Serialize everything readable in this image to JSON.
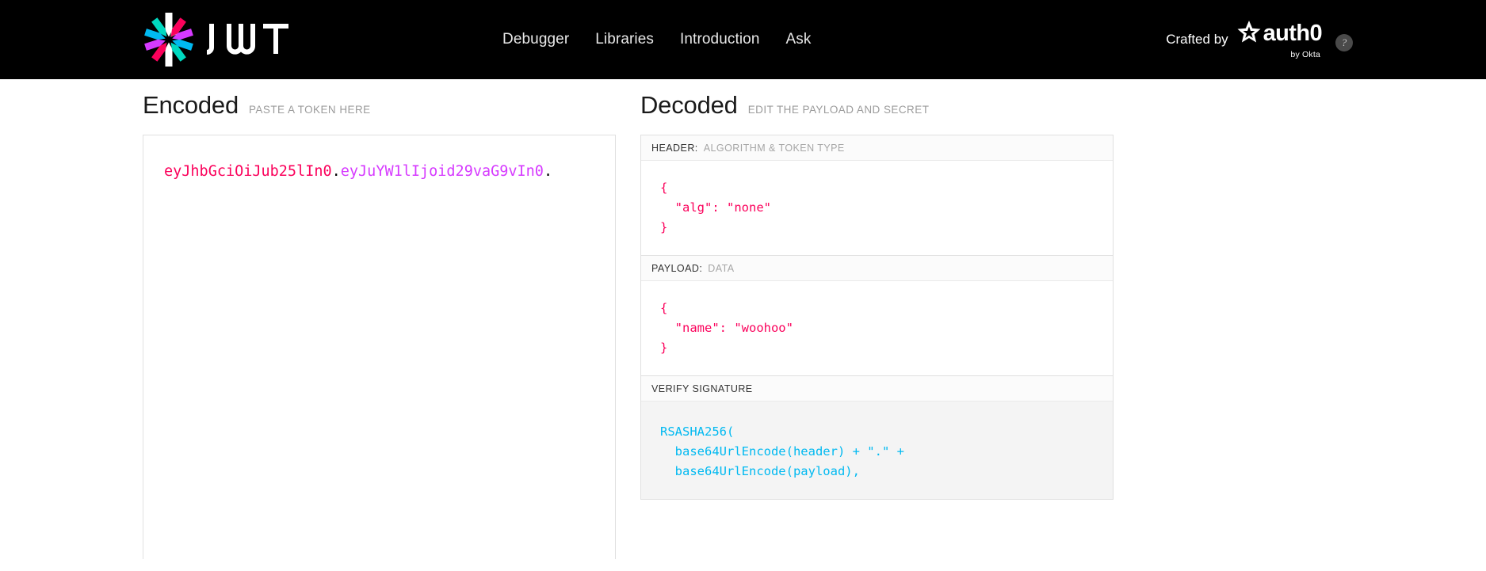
{
  "header": {
    "brand_name": "JWT",
    "logo_icon": "jwt-starburst-logo",
    "nav": [
      {
        "label": "Debugger",
        "name": "nav-debugger"
      },
      {
        "label": "Libraries",
        "name": "nav-libraries"
      },
      {
        "label": "Introduction",
        "name": "nav-introduction"
      },
      {
        "label": "Ask",
        "name": "nav-ask"
      }
    ],
    "crafted_by_label": "Crafted by",
    "auth0_wordmark": "auth0",
    "auth0_tagline": "by Okta",
    "auth0_icon": "auth0-shield-icon",
    "help_badge": "?",
    "background_color": "#000000"
  },
  "encoded": {
    "title": "Encoded",
    "subtitle": "PASTE A TOKEN HERE",
    "token": {
      "header_part": "eyJhbGciOiJub25lIn0",
      "payload_part": "eyJuYW1lIjoid29vaG9vIn0",
      "signature_part": "",
      "separator": ".",
      "full": "eyJhbGciOiJub25lIn0.eyJuYW1lIjoid29vaG9vIn0."
    },
    "colors": {
      "header": "#fb015b",
      "payload": "#d63aff",
      "signature": "#00b9f1",
      "separator": "#000000"
    }
  },
  "decoded": {
    "title": "Decoded",
    "subtitle": "EDIT THE PAYLOAD AND SECRET",
    "panels": [
      {
        "label_main": "HEADER:",
        "label_sub": "ALGORITHM & TOKEN TYPE",
        "content": "{\n  \"alg\": \"none\"\n}"
      },
      {
        "label_main": "PAYLOAD:",
        "label_sub": "DATA",
        "content": "{\n  \"name\": \"woohoo\"\n}"
      }
    ],
    "verify": {
      "label_main": "VERIFY SIGNATURE",
      "label_sub": "",
      "content": "RSASHA256(\n  base64UrlEncode(header) + \".\" +\n  base64UrlEncode(payload),"
    },
    "colors": {
      "json_text": "#fb015b",
      "signature_text": "#00b9f1",
      "signature_bg": "#f4f4f4"
    }
  }
}
